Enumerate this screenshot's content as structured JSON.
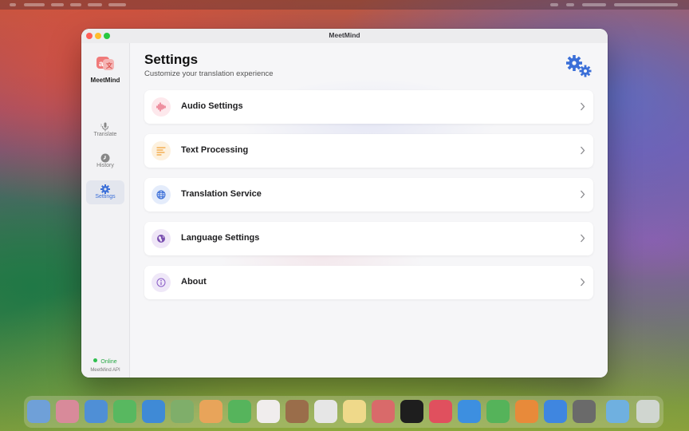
{
  "window": {
    "title": "MeetMind"
  },
  "sidebar": {
    "app_name": "MeetMind",
    "logo_icon": "translate-logo-icon",
    "items": [
      {
        "label": "Translate",
        "icon": "microphone-icon",
        "active": false
      },
      {
        "label": "History",
        "icon": "clock-icon",
        "active": false
      },
      {
        "label": "Settings",
        "icon": "gear-icon",
        "active": true
      }
    ],
    "status": {
      "label": "Online",
      "sub": "MeetMind API",
      "color": "#2fbf4f"
    }
  },
  "main": {
    "title": "Settings",
    "subtitle": "Customize your translation experience",
    "header_icon": "gears-icon",
    "accent": "#3b6fd8",
    "rows": [
      {
        "label": "Audio Settings",
        "icon": "waveform-icon",
        "icon_color": "#e5566f",
        "bg": "#fde8ec"
      },
      {
        "label": "Text Processing",
        "icon": "text-lines-icon",
        "icon_color": "#f2a23a",
        "bg": "#fdf1de"
      },
      {
        "label": "Translation Service",
        "icon": "globe-icon",
        "icon_color": "#3b6fd8",
        "bg": "#e4ecfb"
      },
      {
        "label": "Language Settings",
        "icon": "globe-americas-icon",
        "icon_color": "#7a4fb0",
        "bg": "#efe6f7"
      },
      {
        "label": "About",
        "icon": "info-icon",
        "icon_color": "#8a5cc6",
        "bg": "#efe8f8"
      }
    ]
  }
}
